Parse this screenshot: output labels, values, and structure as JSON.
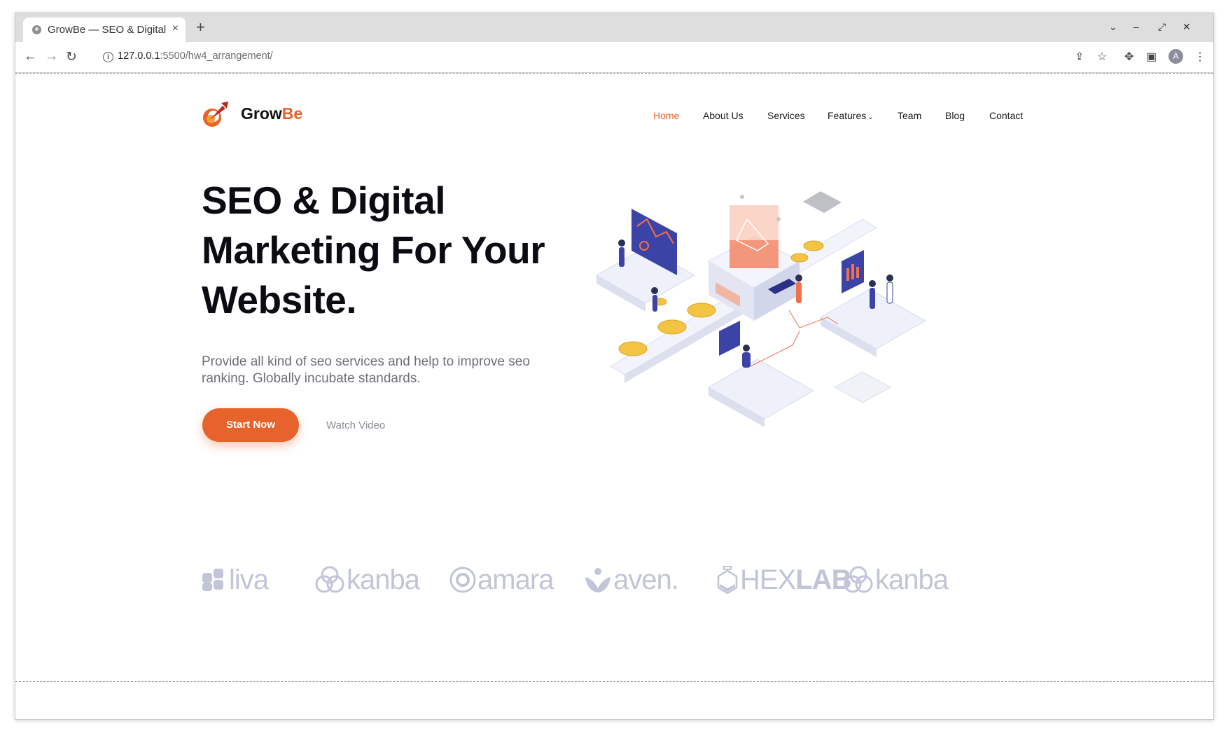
{
  "browser": {
    "tab_title": "GrowBe — SEO & Digital",
    "tab_close": "×",
    "new_tab": "+",
    "url_host": "127.0.0.1",
    "url_path": ":5500/hw4_arrangement/",
    "profile_initial": "A"
  },
  "site": {
    "brand_grow": "Grow",
    "brand_be": "Be",
    "accent_color": "#e8622b",
    "nav": [
      {
        "label": "Home",
        "active": true
      },
      {
        "label": "About Us"
      },
      {
        "label": "Services"
      },
      {
        "label": "Features"
      },
      {
        "label": "Team"
      },
      {
        "label": "Blog"
      },
      {
        "label": "Contact"
      }
    ],
    "hero": {
      "title_line1": "SEO & Digital",
      "title_line2": "Marketing For Your",
      "title_line3": "Website.",
      "subtitle": "Provide all kind of seo services and help to improve seo ranking. Globally incubate standards.",
      "cta_primary": "Start Now",
      "cta_secondary": "Watch Video"
    },
    "partners": [
      {
        "name": "liva",
        "icon": "flower-logo-icon"
      },
      {
        "name": "kanba",
        "icon": "interlocked-circles-logo-icon"
      },
      {
        "name": "amara",
        "icon": "at-sign-logo-icon"
      },
      {
        "name": "aven.",
        "icon": "leaf-logo-icon"
      },
      {
        "name_a": "HEX",
        "name_b": "LAB",
        "icon": "flask-logo-icon"
      },
      {
        "name": "kanba",
        "icon": "interlocked-circles-logo-icon"
      }
    ]
  }
}
